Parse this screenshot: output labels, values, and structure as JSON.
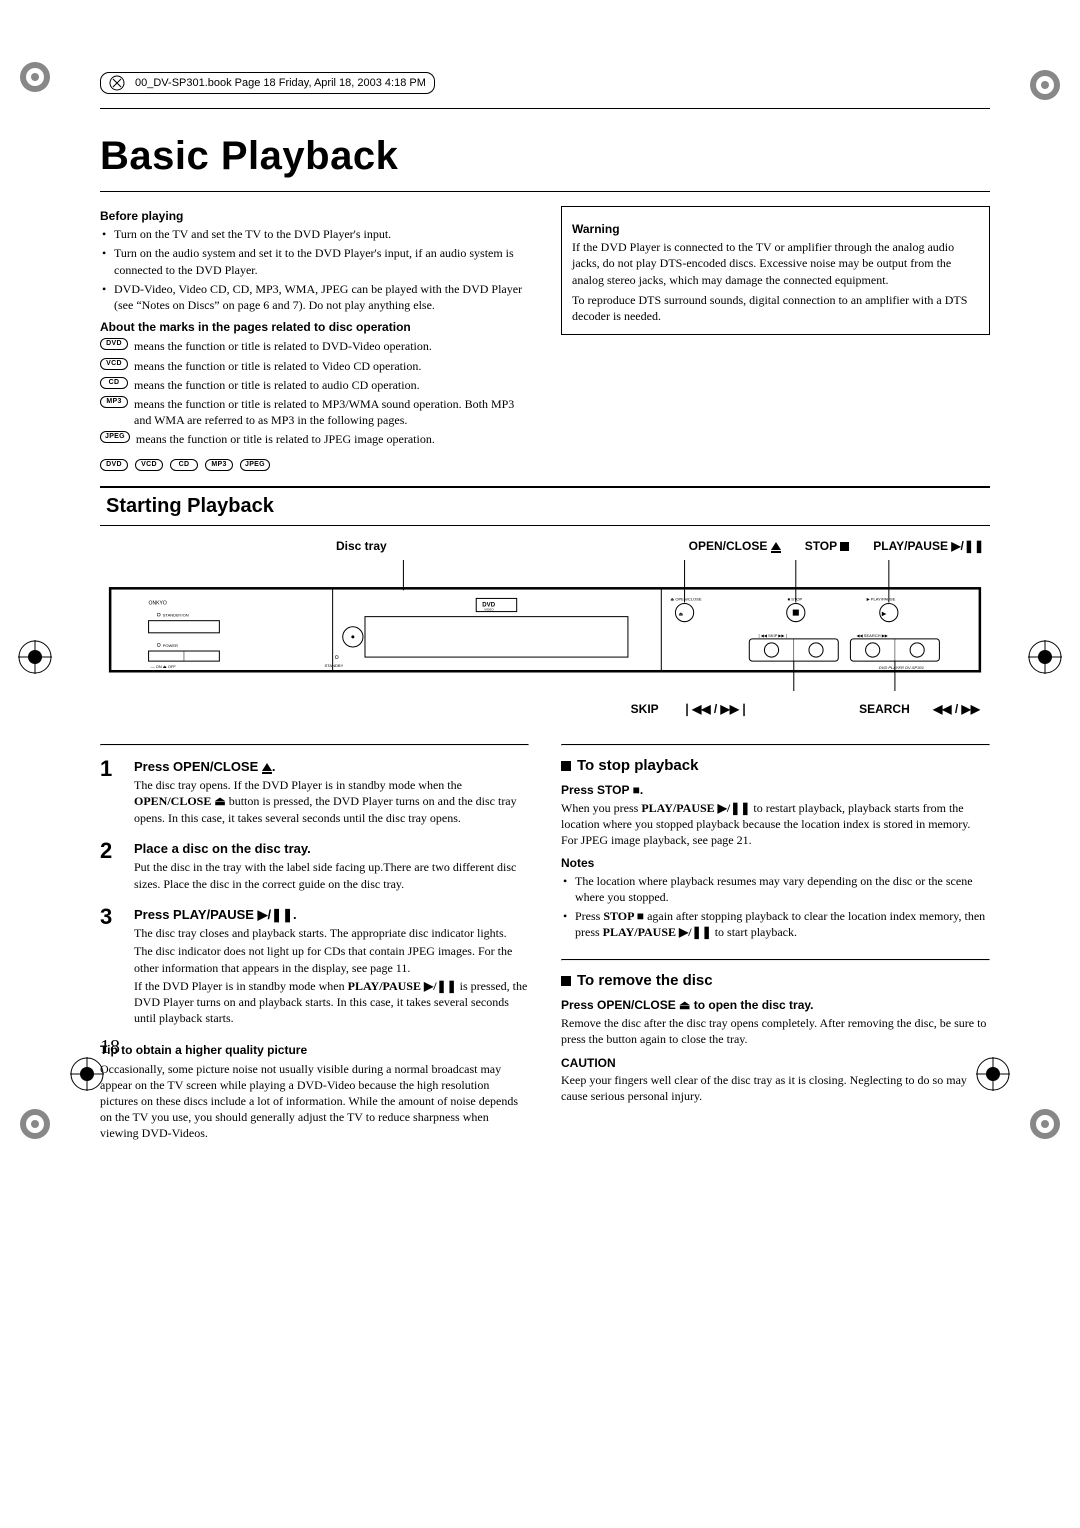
{
  "doc_header": "00_DV-SP301.book  Page 18  Friday, April 18, 2003  4:18 PM",
  "title": "Basic Playback",
  "before_playing": {
    "heading": "Before playing",
    "bullets": [
      "Turn on the TV and set the TV to the DVD Player's input.",
      "Turn on the audio system and set it to the DVD Player's input, if an audio system is connected to the DVD Player.",
      "DVD-Video, Video CD, CD, MP3, WMA, JPEG can be played with the DVD Player (see “Notes on Discs” on page 6 and 7). Do not play anything else."
    ]
  },
  "about_marks": {
    "heading": "About the marks in the pages related to disc operation",
    "rows": [
      {
        "badge": "DVD",
        "text": "means the function or title is related to DVD-Video operation."
      },
      {
        "badge": "VCD",
        "text": "means the function or title is related to Video CD operation."
      },
      {
        "badge": "CD",
        "text": "means the function or title is related to audio CD operation."
      },
      {
        "badge": "MP3",
        "text": "means the function or title is related to MP3/WMA sound operation. Both MP3 and WMA are referred to as MP3 in the following pages."
      },
      {
        "badge": "JPEG",
        "text": "means the function or title is related to JPEG image operation."
      }
    ],
    "badge_row": [
      "DVD",
      "VCD",
      "CD",
      "MP3",
      "JPEG"
    ]
  },
  "warning": {
    "heading": "Warning",
    "para1": "If the DVD Player is connected to the TV or amplifier through the analog audio jacks, do not play DTS-encoded discs. Excessive noise may be output from the analog stereo jacks, which may damage the connected equipment.",
    "para2": "To reproduce DTS surround sounds, digital connection to an amplifier with a DTS decoder is needed."
  },
  "section_heading": "Starting Playback",
  "device": {
    "disc_tray_label": "Disc tray",
    "open_close_label": "OPEN/CLOSE",
    "stop_label": "STOP",
    "play_pause_label": "PLAY/PAUSE",
    "skip_label": "SKIP",
    "search_label": "SEARCH",
    "brand": "ONKYO",
    "standby_on": "STANDBY/ON",
    "power": "POWER",
    "on_off": "ON   OFF",
    "standby": "STANDBY",
    "dvd_video_logo": "DVD VIDEO",
    "panel_open_close": "OPEN/CLOSE",
    "panel_stop": "STOP",
    "panel_play_pause": "PLAY/PAUSE",
    "panel_skip": "SKIP",
    "panel_search": "SEARCH",
    "model": "DVD PLAYER  DV-SP301",
    "open_close_icon": "⏏",
    "stop_icon": "■",
    "play_pause_icon": "▶/❚❚",
    "skip_icon": "❘◀◀ / ▶▶❘",
    "search_icon": "◀◀ / ▶▶"
  },
  "steps": [
    {
      "num": "1",
      "title_pre": "Press OPEN/CLOSE ",
      "title_icon": "⏏",
      "title_post": ".",
      "paras": [
        "The disc tray opens. If the DVD Player is in standby mode when the <b>OPEN/CLOSE ⏏</b> button is pressed, the DVD Player turns on and the disc tray opens. In this case, it takes several seconds until the disc tray opens."
      ]
    },
    {
      "num": "2",
      "title_pre": "Place a disc on the disc tray.",
      "title_icon": "",
      "title_post": "",
      "paras": [
        "Put the disc in the tray with the label side facing up.There are two different disc sizes. Place the disc in the correct guide on the disc tray."
      ]
    },
    {
      "num": "3",
      "title_pre": "Press PLAY/PAUSE ",
      "title_icon": "▶/❚❚",
      "title_post": ".",
      "paras": [
        "The disc tray closes and playback starts. The appropriate disc indicator lights.",
        "The disc indicator does not light up for CDs that contain JPEG images. For the other information that appears in the display, see page 11.",
        "If the DVD Player is in standby mode when <b>PLAY/PAUSE ▶/❚❚</b> is pressed, the DVD Player turns on and playback starts. In this case, it takes several seconds until playback starts."
      ]
    }
  ],
  "tip": {
    "heading": "Tip to obtain a higher quality picture",
    "text": "Occasionally, some picture noise not usually visible during a normal broadcast may appear on the TV screen while playing a DVD-Video because the high resolution pictures on these discs include a lot of information. While the amount of noise depends on the TV you use, you should generally adjust the TV to reduce sharpness when viewing DVD-Videos."
  },
  "stop_playback": {
    "heading": "To stop playback",
    "sub": "Press STOP ■.",
    "para": "When you press <b>PLAY/PAUSE ▶/❚❚</b> to restart playback, playback starts from the location where you stopped playback because the location index is stored in memory.",
    "para2": "For JPEG image playback, see page 21.",
    "notes_heading": "Notes",
    "notes": [
      "The location where playback resumes may vary depending on the disc or the scene where you stopped.",
      "Press <b>STOP ■</b> again after stopping playback to clear the location index memory, then press <b>PLAY/PAUSE ▶/❚❚</b> to start playback."
    ]
  },
  "remove_disc": {
    "heading": "To remove the disc",
    "sub": "Press OPEN/CLOSE ⏏ to open the disc tray.",
    "para": "Remove the disc after the disc tray opens completely. After removing the disc, be sure to press the button again to close the tray."
  },
  "caution": {
    "heading": "CAUTION",
    "text": "Keep your fingers well clear of the disc tray as it is closing. Neglecting to do so may cause serious personal injury."
  },
  "page_number": "18"
}
